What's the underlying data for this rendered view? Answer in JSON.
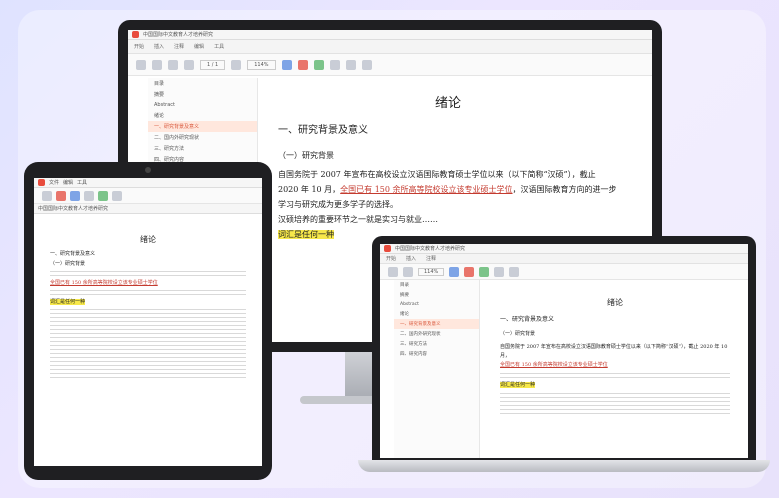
{
  "menu": {
    "home": "开始",
    "insert": "插入",
    "annotate": "注释",
    "edit": "编辑",
    "tools": "工具",
    "file": "文件"
  },
  "monitor": {
    "tab_title": "中国国际中文教育人才培养研究",
    "page_field": "1 / 1",
    "zoom": "114%"
  },
  "tablet": {
    "tab_title": "中国国际中文教育人才培养研究"
  },
  "outline": [
    "目录",
    "摘要",
    "Abstract",
    "绪论",
    "一、研究背景及意义",
    "二、国内外研究现状",
    "三、研究方法",
    "四、研究内容"
  ],
  "doc": {
    "title": "绪论",
    "section1": "一、研究背景及意义",
    "subsection1": "（一）研究背景",
    "p1_a": "自国务院于 2007 年宣布在高校设立汉语国际教育硕士学位以来（以下简称“汉硕”），截止 2020 年 10 月，",
    "p1_underlined": "全国已有 150 余所高等院校设立该专业硕士学位",
    "p1_b": "，汉语国际教育方向的进一步学习与研究成为更多学子的选择。",
    "p2": "汉硕培养的重要环节之一就是实习与就业……",
    "p2_highlight": "词汇是任何一种"
  }
}
